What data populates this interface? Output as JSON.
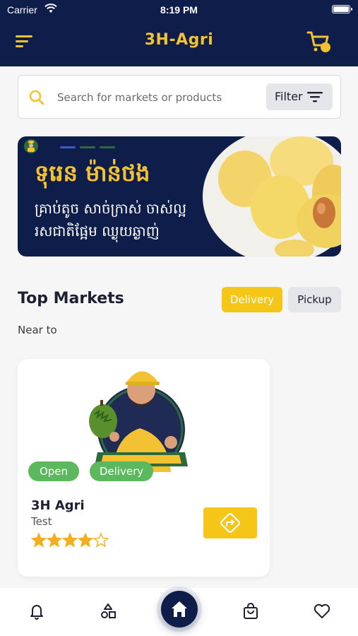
{
  "status_bar": {
    "carrier": "Carrier",
    "time": "8:19 PM"
  },
  "header": {
    "title": "3H-Agri"
  },
  "search": {
    "placeholder": "Search for markets or products",
    "filter_label": "Filter"
  },
  "banner": {
    "title": "ទុរេន ម៉ាន់ថង",
    "text": "គ្រាប់តូច សាច់ក្រាស់ ចាស់ល្អ រសជាតិផ្អែម ឈ្ងុយឆ្ងាញ់"
  },
  "markets": {
    "title": "Top Markets",
    "tabs": [
      {
        "label": "Delivery",
        "active": true
      },
      {
        "label": "Pickup",
        "active": false
      }
    ],
    "near_label": "Near to",
    "items": [
      {
        "name": "3H Agri",
        "subtitle": "Test",
        "badges": [
          "Open",
          "Delivery"
        ],
        "rating": 4,
        "rating_max": 5
      }
    ]
  },
  "bottom_nav": {
    "items": [
      "bell-icon",
      "categories-icon",
      "home-icon",
      "shopping-bag-icon",
      "heart-icon"
    ],
    "active": "home-icon"
  },
  "colors": {
    "primary": "#0f1d4a",
    "accent": "#f5c518",
    "success": "#5cb85c"
  }
}
